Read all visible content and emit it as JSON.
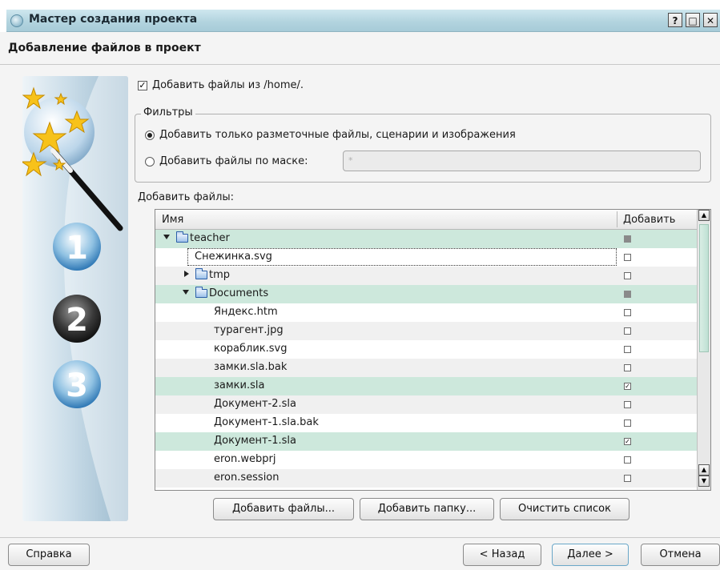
{
  "window": {
    "title": "Мастер создания проекта",
    "help_label": "?",
    "max_label": "□",
    "close_label": "✕"
  },
  "page": {
    "title": "Добавление файлов в проект"
  },
  "add_from": {
    "checked": true,
    "label": "Добавить файлы из /home/."
  },
  "filters": {
    "title": "Фильтры",
    "option_markup": {
      "label": "Добавить только разметочные файлы, сценарии и изображения",
      "selected": true
    },
    "option_mask": {
      "label": "Добавить файлы по маске:",
      "selected": false
    },
    "mask_value": "*"
  },
  "files_section": {
    "label": "Добавить файлы:"
  },
  "tree": {
    "columns": {
      "name": "Имя",
      "add": "Добавить"
    },
    "rows": [
      {
        "name": "teacher",
        "check": "partial"
      },
      {
        "name": "Снежинка.svg",
        "check": "unchecked"
      },
      {
        "name": "tmp",
        "check": "unchecked"
      },
      {
        "name": "Documents",
        "check": "partial"
      },
      {
        "name": "Яндекс.htm",
        "check": "unchecked"
      },
      {
        "name": "турагент.jpg",
        "check": "unchecked"
      },
      {
        "name": "кораблик.svg",
        "check": "unchecked"
      },
      {
        "name": "замки.sla.bak",
        "check": "unchecked"
      },
      {
        "name": "замки.sla",
        "check": "checked"
      },
      {
        "name": "Документ-2.sla",
        "check": "unchecked"
      },
      {
        "name": "Документ-1.sla.bak",
        "check": "unchecked"
      },
      {
        "name": "Документ-1.sla",
        "check": "checked"
      },
      {
        "name": "eron.webprj",
        "check": "unchecked"
      },
      {
        "name": "eron.session",
        "check": "unchecked"
      }
    ]
  },
  "actions": {
    "add_files": "Добавить файлы...",
    "add_folder": "Добавить папку...",
    "clear_list": "Очистить список"
  },
  "footer": {
    "help": "Справка",
    "back": "< Назад",
    "next": "Далее >",
    "cancel": "Отмена"
  }
}
